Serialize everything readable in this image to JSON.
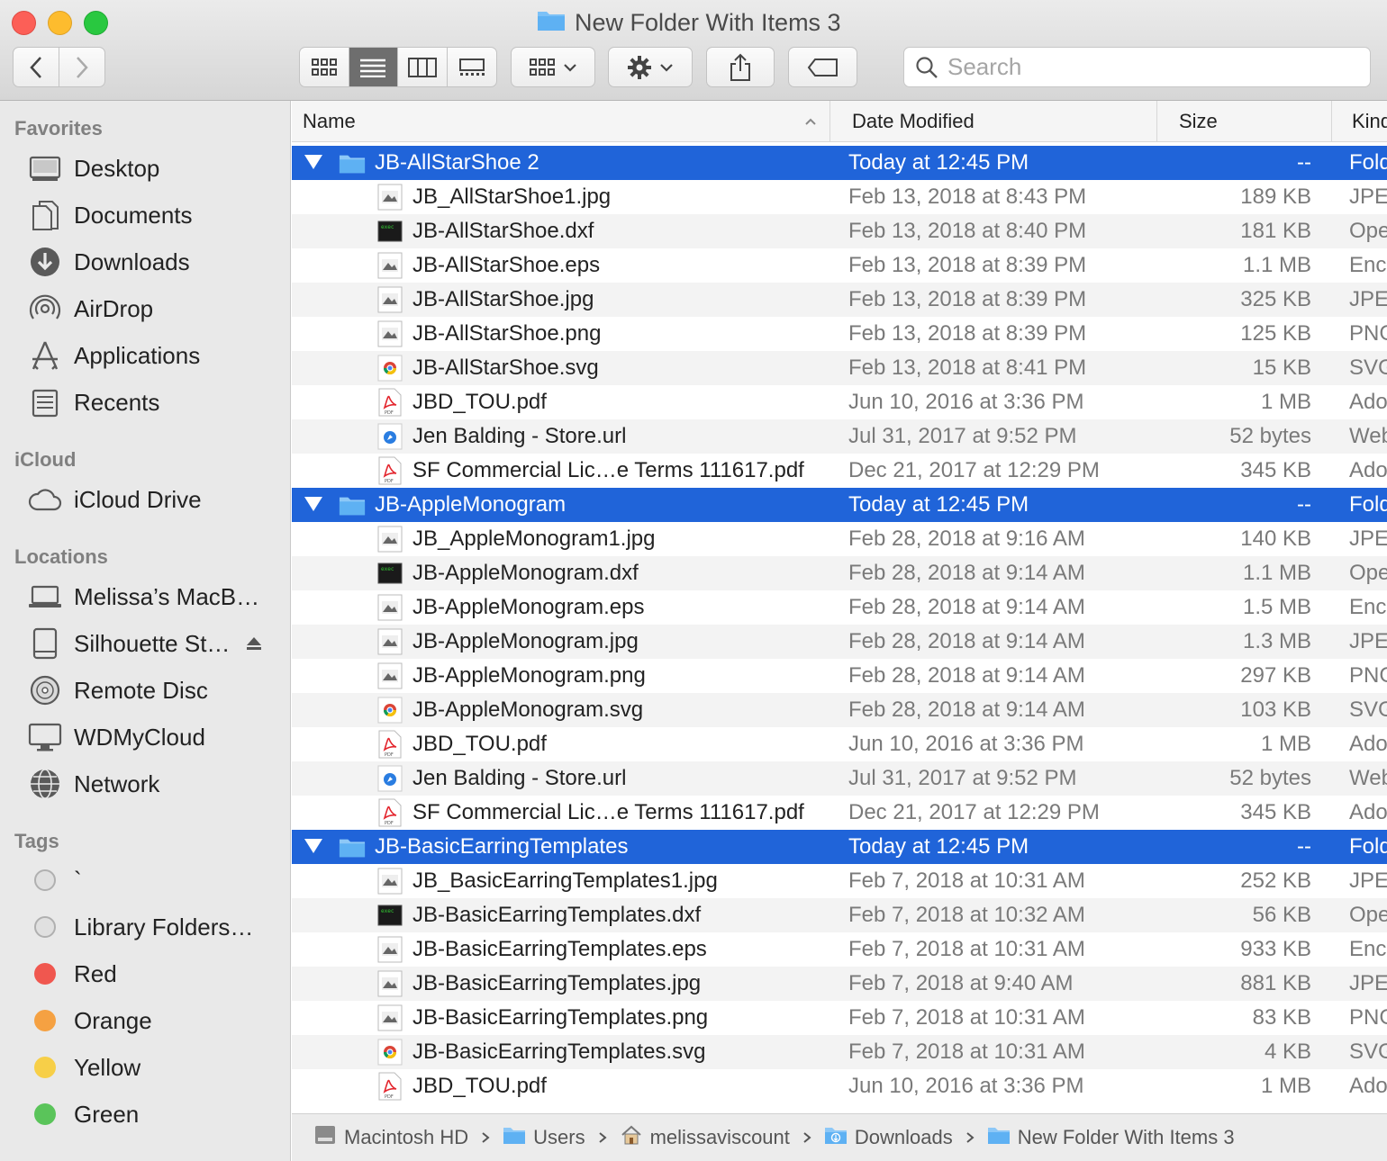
{
  "window": {
    "title": "New Folder With Items 3"
  },
  "toolbar": {
    "search_placeholder": "Search",
    "view_modes": [
      "icon-view",
      "list-view",
      "column-view",
      "gallery-view"
    ],
    "active_view": "list-view"
  },
  "sidebar": {
    "favorites_title": "Favorites",
    "favorites": [
      {
        "label": "Desktop",
        "icon": "desktop-icon"
      },
      {
        "label": "Documents",
        "icon": "documents-icon"
      },
      {
        "label": "Downloads",
        "icon": "downloads-icon"
      },
      {
        "label": "AirDrop",
        "icon": "airdrop-icon"
      },
      {
        "label": "Applications",
        "icon": "applications-icon"
      },
      {
        "label": "Recents",
        "icon": "recents-icon"
      }
    ],
    "icloud_title": "iCloud",
    "icloud": [
      {
        "label": "iCloud Drive",
        "icon": "cloud-icon"
      }
    ],
    "locations_title": "Locations",
    "locations": [
      {
        "label": "Melissa’s MacB…",
        "icon": "laptop-icon"
      },
      {
        "label": "Silhouette St…",
        "icon": "drive-icon"
      },
      {
        "label": "Remote Disc",
        "icon": "disc-icon"
      },
      {
        "label": "WDMyCloud",
        "icon": "monitor-icon"
      },
      {
        "label": "Network",
        "icon": "network-icon"
      }
    ],
    "tags_title": "Tags",
    "tags": [
      {
        "label": "`",
        "color": "#d4d4d4"
      },
      {
        "label": "Library Folders…",
        "color": "#d4d4d4"
      },
      {
        "label": "Red",
        "color": "#f0574f"
      },
      {
        "label": "Orange",
        "color": "#f5a142"
      },
      {
        "label": "Yellow",
        "color": "#f7cf48"
      },
      {
        "label": "Green",
        "color": "#5ac45a"
      }
    ]
  },
  "columns": {
    "name": "Name",
    "date": "Date Modified",
    "size": "Size",
    "kind": "Kind"
  },
  "rows": [
    {
      "type": "folder",
      "name": "JB-AllStarShoe 2",
      "date": "Today at 12:45 PM",
      "size": "--",
      "kind": "Folder",
      "icon": "folder-icon"
    },
    {
      "type": "file",
      "name": "JB_AllStarShoe1.jpg",
      "date": "Feb 13, 2018 at 8:43 PM",
      "size": "189 KB",
      "kind": "JPEG image",
      "icon": "image-icon"
    },
    {
      "type": "file",
      "name": "JB-AllStarShoe.dxf",
      "date": "Feb 13, 2018 at 8:40 PM",
      "size": "181 KB",
      "kind": "OpenOffice.org Drawing",
      "icon": "terminal-doc-icon"
    },
    {
      "type": "file",
      "name": "JB-AllStarShoe.eps",
      "date": "Feb 13, 2018 at 8:39 PM",
      "size": "1.1 MB",
      "kind": "Encapsulated PostScript",
      "icon": "image-icon"
    },
    {
      "type": "file",
      "name": "JB-AllStarShoe.jpg",
      "date": "Feb 13, 2018 at 8:39 PM",
      "size": "325 KB",
      "kind": "JPEG image",
      "icon": "image-icon"
    },
    {
      "type": "file",
      "name": "JB-AllStarShoe.png",
      "date": "Feb 13, 2018 at 8:39 PM",
      "size": "125 KB",
      "kind": "PNG image",
      "icon": "image-icon"
    },
    {
      "type": "file",
      "name": "JB-AllStarShoe.svg",
      "date": "Feb 13, 2018 at 8:41 PM",
      "size": "15 KB",
      "kind": "SVG document",
      "icon": "chrome-doc-icon"
    },
    {
      "type": "file",
      "name": "JBD_TOU.pdf",
      "date": "Jun 10, 2016 at 3:36 PM",
      "size": "1 MB",
      "kind": "Adobe PDF document",
      "icon": "pdf-icon"
    },
    {
      "type": "file",
      "name": "Jen Balding - Store.url",
      "date": "Jul 31, 2017 at 9:52 PM",
      "size": "52 bytes",
      "kind": "Web site location",
      "icon": "url-icon"
    },
    {
      "type": "file",
      "name": "SF Commercial Lic…e Terms 111617.pdf",
      "date": "Dec 21, 2017 at 12:29 PM",
      "size": "345 KB",
      "kind": "Adobe PDF document",
      "icon": "pdf-icon"
    },
    {
      "type": "folder",
      "name": "JB-AppleMonogram",
      "date": "Today at 12:45 PM",
      "size": "--",
      "kind": "Folder",
      "icon": "folder-icon"
    },
    {
      "type": "file",
      "name": "JB_AppleMonogram1.jpg",
      "date": "Feb 28, 2018 at 9:16 AM",
      "size": "140 KB",
      "kind": "JPEG image",
      "icon": "image-icon"
    },
    {
      "type": "file",
      "name": "JB-AppleMonogram.dxf",
      "date": "Feb 28, 2018 at 9:14 AM",
      "size": "1.1 MB",
      "kind": "OpenOffice.org Drawing",
      "icon": "terminal-doc-icon"
    },
    {
      "type": "file",
      "name": "JB-AppleMonogram.eps",
      "date": "Feb 28, 2018 at 9:14 AM",
      "size": "1.5 MB",
      "kind": "Encapsulated PostScript",
      "icon": "image-icon"
    },
    {
      "type": "file",
      "name": "JB-AppleMonogram.jpg",
      "date": "Feb 28, 2018 at 9:14 AM",
      "size": "1.3 MB",
      "kind": "JPEG image",
      "icon": "image-icon"
    },
    {
      "type": "file",
      "name": "JB-AppleMonogram.png",
      "date": "Feb 28, 2018 at 9:14 AM",
      "size": "297 KB",
      "kind": "PNG image",
      "icon": "image-icon"
    },
    {
      "type": "file",
      "name": "JB-AppleMonogram.svg",
      "date": "Feb 28, 2018 at 9:14 AM",
      "size": "103 KB",
      "kind": "SVG document",
      "icon": "chrome-doc-icon"
    },
    {
      "type": "file",
      "name": "JBD_TOU.pdf",
      "date": "Jun 10, 2016 at 3:36 PM",
      "size": "1 MB",
      "kind": "Adobe PDF document",
      "icon": "pdf-icon"
    },
    {
      "type": "file",
      "name": "Jen Balding - Store.url",
      "date": "Jul 31, 2017 at 9:52 PM",
      "size": "52 bytes",
      "kind": "Web site location",
      "icon": "url-icon"
    },
    {
      "type": "file",
      "name": "SF Commercial Lic…e Terms 111617.pdf",
      "date": "Dec 21, 2017 at 12:29 PM",
      "size": "345 KB",
      "kind": "Adobe PDF document",
      "icon": "pdf-icon"
    },
    {
      "type": "folder",
      "name": "JB-BasicEarringTemplates",
      "date": "Today at 12:45 PM",
      "size": "--",
      "kind": "Folder",
      "icon": "folder-icon"
    },
    {
      "type": "file",
      "name": "JB_BasicEarringTemplates1.jpg",
      "date": "Feb 7, 2018 at 10:31 AM",
      "size": "252 KB",
      "kind": "JPEG image",
      "icon": "image-icon"
    },
    {
      "type": "file",
      "name": "JB-BasicEarringTemplates.dxf",
      "date": "Feb 7, 2018 at 10:32 AM",
      "size": "56 KB",
      "kind": "OpenOffice.org Drawing",
      "icon": "terminal-doc-icon"
    },
    {
      "type": "file",
      "name": "JB-BasicEarringTemplates.eps",
      "date": "Feb 7, 2018 at 10:31 AM",
      "size": "933 KB",
      "kind": "Encapsulated PostScript",
      "icon": "image-icon"
    },
    {
      "type": "file",
      "name": "JB-BasicEarringTemplates.jpg",
      "date": "Feb 7, 2018 at 9:40 AM",
      "size": "881 KB",
      "kind": "JPEG image",
      "icon": "image-icon"
    },
    {
      "type": "file",
      "name": "JB-BasicEarringTemplates.png",
      "date": "Feb 7, 2018 at 10:31 AM",
      "size": "83 KB",
      "kind": "PNG image",
      "icon": "image-icon"
    },
    {
      "type": "file",
      "name": "JB-BasicEarringTemplates.svg",
      "date": "Feb 7, 2018 at 10:31 AM",
      "size": "4 KB",
      "kind": "SVG document",
      "icon": "chrome-doc-icon"
    },
    {
      "type": "file",
      "name": "JBD_TOU.pdf",
      "date": "Jun 10, 2016 at 3:36 PM",
      "size": "1 MB",
      "kind": "Adobe PDF document",
      "icon": "pdf-icon"
    }
  ],
  "pathbar": [
    {
      "label": "Macintosh HD",
      "icon": "hard-drive-icon"
    },
    {
      "label": "Users",
      "icon": "folder-icon"
    },
    {
      "label": "melissaviscount",
      "icon": "home-icon"
    },
    {
      "label": "Downloads",
      "icon": "downloads-folder-icon"
    },
    {
      "label": "New Folder With Items 3",
      "icon": "folder-icon"
    }
  ],
  "colors": {
    "selection": "#2064d9",
    "folder": "#5eb1f3"
  }
}
